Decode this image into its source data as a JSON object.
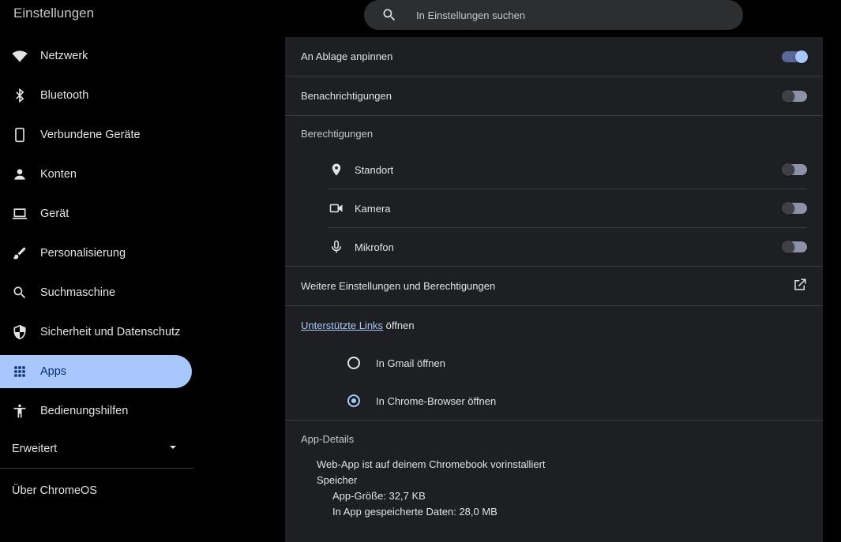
{
  "header": {
    "title": "Einstellungen",
    "search_placeholder": "In Einstellungen suchen"
  },
  "sidebar": {
    "items": [
      {
        "label": "Netzwerk",
        "icon": "wifi-icon"
      },
      {
        "label": "Bluetooth",
        "icon": "bluetooth-icon"
      },
      {
        "label": "Verbundene Geräte",
        "icon": "phone-icon"
      },
      {
        "label": "Konten",
        "icon": "person-icon"
      },
      {
        "label": "Gerät",
        "icon": "laptop-icon"
      },
      {
        "label": "Personalisierung",
        "icon": "brush-icon"
      },
      {
        "label": "Suchmaschine",
        "icon": "search-icon"
      },
      {
        "label": "Sicherheit und Datenschutz",
        "icon": "shield-icon"
      },
      {
        "label": "Apps",
        "icon": "apps-grid-icon",
        "active": true
      },
      {
        "label": "Bedienungshilfen",
        "icon": "accessibility-icon"
      }
    ],
    "advanced_label": "Erweitert",
    "about_label": "Über ChromeOS"
  },
  "panel": {
    "pin_label": "An Ablage anpinnen",
    "pin_on": true,
    "notifications_label": "Benachrichtigungen",
    "notifications_on": false,
    "permissions_label": "Berechtigungen",
    "permissions": [
      {
        "label": "Standort",
        "icon": "location-icon",
        "on": false
      },
      {
        "label": "Kamera",
        "icon": "camera-icon",
        "on": false
      },
      {
        "label": "Mikrofon",
        "icon": "mic-icon",
        "on": false
      }
    ],
    "more_settings_label": "Weitere Einstellungen und Berechtigungen",
    "supported_links_link": "Unterstützte Links",
    "supported_links_suffix": " öffnen",
    "radio_options": [
      {
        "label": "In Gmail öffnen",
        "checked": false
      },
      {
        "label": "In Chrome-Browser öffnen",
        "checked": true
      }
    ],
    "details": {
      "label": "App-Details",
      "installed": "Web-App ist auf deinem Chromebook vorinstalliert",
      "storage": "Speicher",
      "app_size": "App-Größe: 32,7 KB",
      "data_size": "In App gespeicherte Daten: 28,0 MB"
    }
  },
  "colors": {
    "accent": "#a8c7fa",
    "panel_bg": "#1e1f22",
    "page_bg": "#000000"
  }
}
